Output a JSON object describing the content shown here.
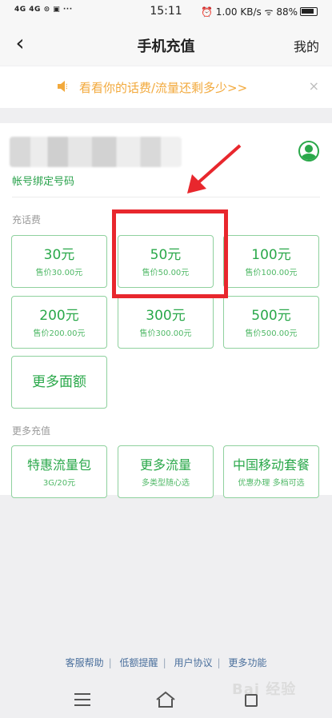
{
  "status_bar": {
    "left_indicators": "4G 4G ⊙ ▣ ···",
    "time": "15:11",
    "right_indicators": "⏰ 1.00 KB/s  ᯤ 88%"
  },
  "nav": {
    "back_glyph": "‹",
    "title": "手机充值",
    "mine_label": "我的"
  },
  "banner": {
    "text": "看看你的话费/流量还剩多少>>",
    "close_glyph": "×"
  },
  "account": {
    "bind_label": "帐号绑定号码"
  },
  "recharge": {
    "section_label": "充话费",
    "tiles": [
      {
        "amount": "30元",
        "price": "售价30.00元"
      },
      {
        "amount": "50元",
        "price": "售价50.00元"
      },
      {
        "amount": "100元",
        "price": "售价100.00元"
      },
      {
        "amount": "200元",
        "price": "售价200.00元"
      },
      {
        "amount": "300元",
        "price": "售价300.00元"
      },
      {
        "amount": "500元",
        "price": "售价500.00元"
      }
    ],
    "more_label": "更多面额"
  },
  "more_recharge": {
    "section_label": "更多充值",
    "tiles": [
      {
        "title": "特惠流量包",
        "sub": "3G/20元"
      },
      {
        "title": "更多流量",
        "sub": "多类型随心选"
      },
      {
        "title": "中国移动套餐",
        "sub": "优惠办理 多档可选"
      }
    ]
  },
  "footer": {
    "links": [
      "客服帮助",
      "低额提醒",
      "用户协议",
      "更多功能"
    ]
  },
  "watermark": "Bai 经验",
  "colors": {
    "accent_green": "#2aa84a",
    "banner_orange": "#f2a93c",
    "highlight_red": "#e8272d"
  }
}
